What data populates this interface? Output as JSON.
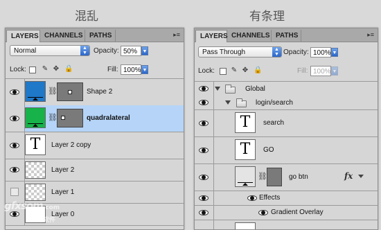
{
  "headings": {
    "left": "混乱",
    "right": "有条理"
  },
  "left_panel": {
    "tabs": [
      "LAYERS",
      "CHANNELS",
      "PATHS"
    ],
    "blend_mode": "Normal",
    "opacity_label": "Opacity:",
    "opacity_value": "50%",
    "lock_label": "Lock:",
    "fill_label": "Fill:",
    "fill_value": "100%",
    "layers": [
      {
        "name": "Shape 2",
        "thumb_color": "#1f78c8"
      },
      {
        "name": "quadralateral",
        "thumb_color": "#17b24a"
      },
      {
        "name": "Layer 2 copy"
      },
      {
        "name": "Layer 2"
      },
      {
        "name": "Layer 1"
      },
      {
        "name": "Layer 0"
      }
    ],
    "text_thumb_glyph": "T"
  },
  "right_panel": {
    "tabs": [
      "LAYERS",
      "CHANNELS",
      "PATHS"
    ],
    "blend_mode": "Pass Through",
    "opacity_label": "Opacity:",
    "opacity_value": "100%",
    "lock_label": "Lock:",
    "fill_label": "Fill:",
    "fill_value": "100%",
    "layers": [
      {
        "name": "Global"
      },
      {
        "name": "login/search"
      },
      {
        "name": "search"
      },
      {
        "name": "GO"
      },
      {
        "name": "go btn"
      },
      {
        "name": "Effects"
      },
      {
        "name": "Gradient Overlay"
      }
    ],
    "text_thumb_glyph": "T",
    "fx_label": "fx"
  },
  "watermark": {
    "text": "gfxsom",
    "suffix": ".com",
    "subtext": "设计软件"
  },
  "colors": {
    "selected_row": "#b5d4f8",
    "accent_blue": "#2b66c9"
  }
}
